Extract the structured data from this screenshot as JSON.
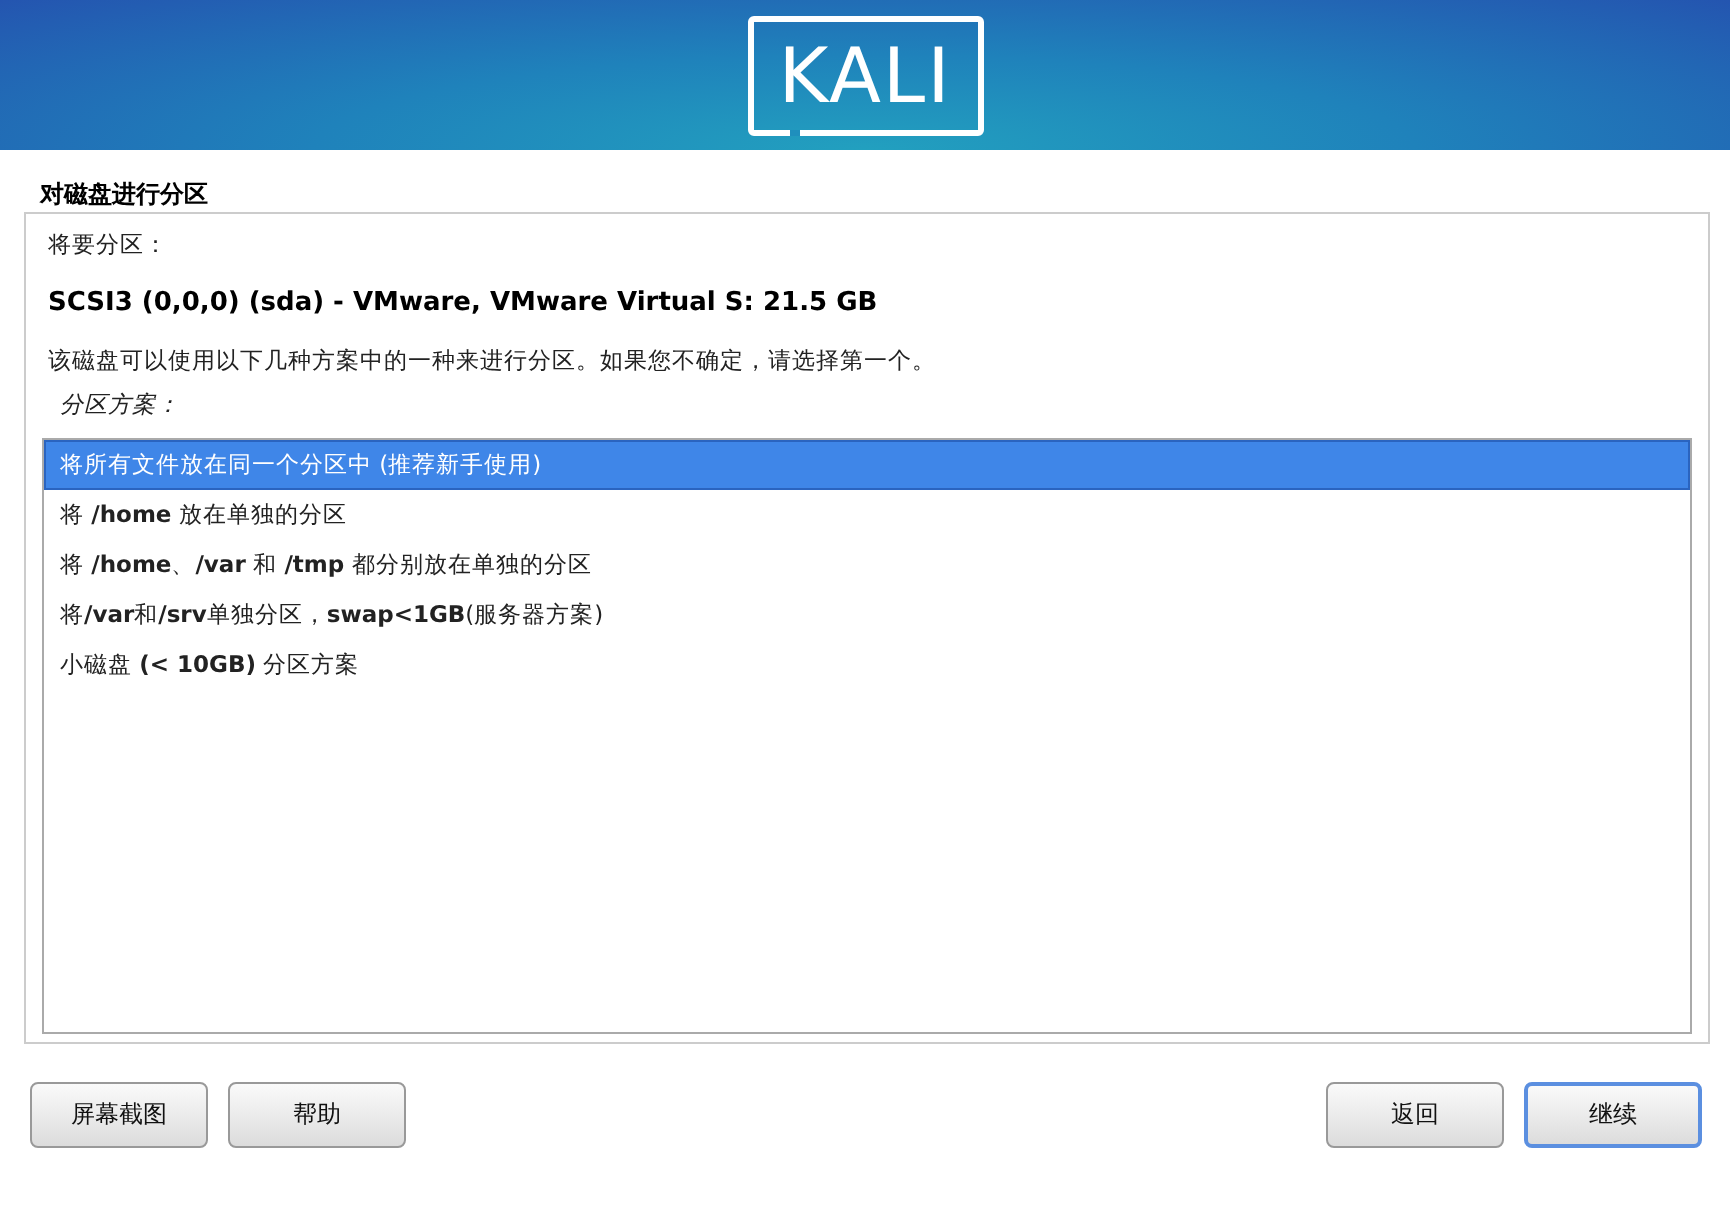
{
  "header": {
    "logo": "KALI"
  },
  "title": "对磁盘进行分区",
  "disk_label": "将要分区：",
  "disk": "SCSI3 (0,0,0) (sda) - VMware, VMware Virtual S: 21.5 GB",
  "description": "该磁盘可以使用以下几种方案中的一种来进行分区。如果您不确定，请选择第一个。",
  "list_label": "分区方案：",
  "options": [
    {
      "label": "将所有文件放在同一个分区中 (推荐新手使用)",
      "selected": true
    },
    {
      "label": "将 **/home** 放在单独的分区",
      "selected": false
    },
    {
      "label": "将 **/home**、**/var** 和 **/tmp** 都分别放在单独的分区",
      "selected": false
    },
    {
      "label": "将**/var**和**/srv**单独分区，**swap<1GB**(服务器方案)",
      "selected": false
    },
    {
      "label": "小磁盘 **(< 10GB)** 分区方案",
      "selected": false
    }
  ],
  "left_buttons": [
    {
      "label": "屏幕截图",
      "focused": false
    },
    {
      "label": "帮助",
      "focused": false
    }
  ],
  "right_buttons": [
    {
      "label": "返回",
      "focused": false
    },
    {
      "label": "继续",
      "focused": true
    }
  ]
}
